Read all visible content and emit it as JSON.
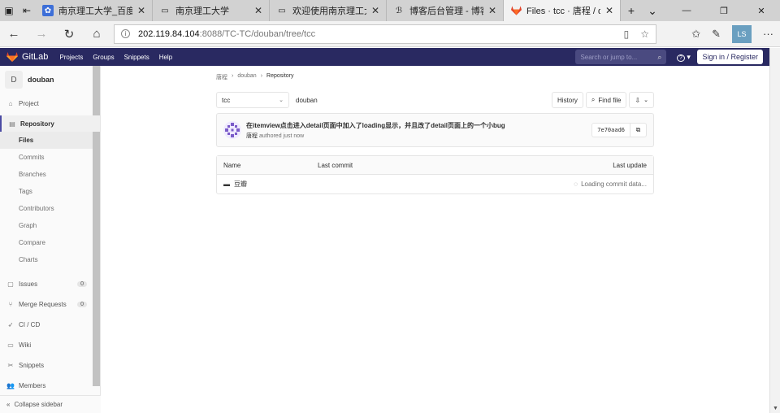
{
  "browser": {
    "tabs": [
      {
        "label": "南京理工大学_百度搜索",
        "icon": "paw-icon",
        "active": false
      },
      {
        "label": "南京理工大学",
        "icon": "page-icon",
        "active": false
      },
      {
        "label": "欢迎使用南京理工大学SSL",
        "icon": "page-icon",
        "active": false
      },
      {
        "label": "博客后台管理 - 博客园",
        "icon": "blog-icon",
        "active": false
      },
      {
        "label": "Files · tcc · 唐程 / douban",
        "icon": "gitlab-icon",
        "active": true
      }
    ],
    "url_host": "202.119.84.104",
    "url_path": ":8088/TC-TC/douban/tree/tcc"
  },
  "header": {
    "logo_text": "GitLab",
    "nav": [
      "Projects",
      "Groups",
      "Snippets",
      "Help"
    ],
    "search_placeholder": "Search or jump to...",
    "help_label": "?",
    "signin_label": "Sign in / Register"
  },
  "sidebar": {
    "project_initial": "D",
    "project_name": "douban",
    "items": [
      {
        "label": "Project",
        "icon": "home-icon"
      },
      {
        "label": "Repository",
        "icon": "book-icon"
      },
      {
        "label": "Issues",
        "icon": "issues-icon",
        "count": "0"
      },
      {
        "label": "Merge Requests",
        "icon": "merge-icon",
        "count": "0"
      },
      {
        "label": "CI / CD",
        "icon": "rocket-icon"
      },
      {
        "label": "Wiki",
        "icon": "wiki-icon"
      },
      {
        "label": "Snippets",
        "icon": "scissors-icon"
      },
      {
        "label": "Members",
        "icon": "users-icon"
      }
    ],
    "repo_sub": [
      "Files",
      "Commits",
      "Branches",
      "Tags",
      "Contributors",
      "Graph",
      "Compare",
      "Charts"
    ],
    "collapse_label": "Collapse sidebar"
  },
  "main": {
    "breadcrumb": [
      "唐程",
      "douban",
      "Repository"
    ],
    "branch": "tcc",
    "path": "douban",
    "history_label": "History",
    "find_file_label": "Find file",
    "commit": {
      "message": "在itemview点击进入detail页面中加入了loading显示，并且改了detail页面上的一个小bug",
      "author": "唐程",
      "meta": "authored just now",
      "sha": "7e70aad6"
    },
    "tree": {
      "headers": [
        "Name",
        "Last commit",
        "Last update"
      ],
      "rows": [
        {
          "name": "豆瓣",
          "last_commit": "",
          "last_update": "Loading commit data..."
        }
      ]
    }
  }
}
